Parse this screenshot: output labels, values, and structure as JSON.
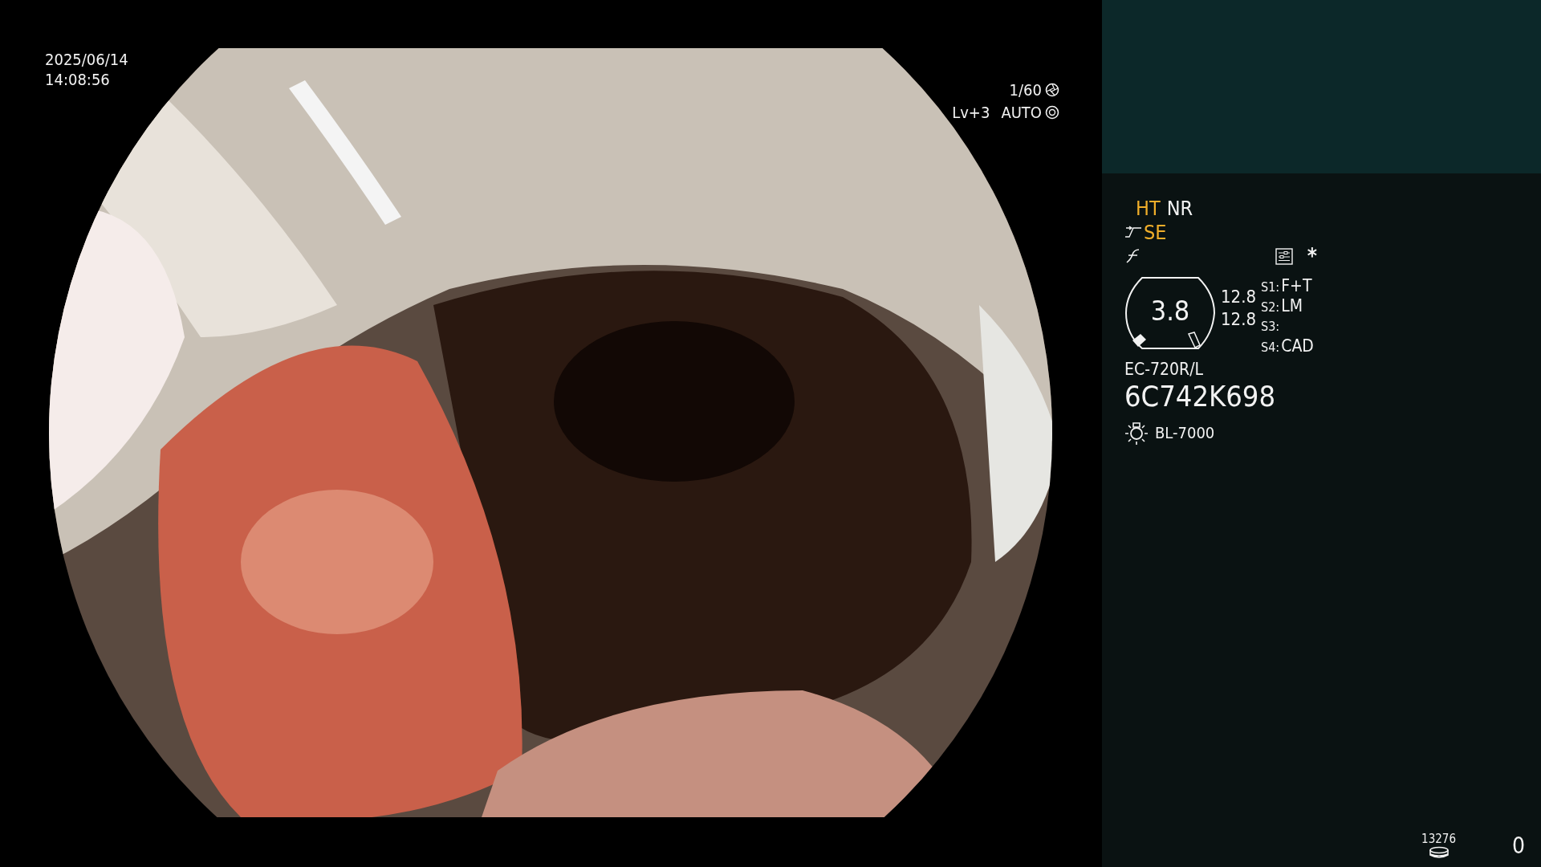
{
  "timestamp": {
    "date": "2025/06/14",
    "time": "14:08:56"
  },
  "camera": {
    "shutter": "1/60",
    "level": "Lv+3",
    "iris": "AUTO"
  },
  "modes": [
    {
      "label": "HT",
      "active": true
    },
    {
      "label": "NR",
      "active": false
    }
  ],
  "enhancement": {
    "label": "SE",
    "active": true
  },
  "asterisk": "*",
  "gauge": {
    "value": "3.8"
  },
  "readings": [
    "12.8",
    "12.8"
  ],
  "switches": [
    {
      "key": "S1:",
      "value": "F+T"
    },
    {
      "key": "S2:",
      "value": "LM"
    },
    {
      "key": "S3:"
    },
    {
      "key": "S4:",
      "value": "CAD"
    }
  ],
  "scope": {
    "model": "EC-720R/L",
    "serial": "6C742K698"
  },
  "light_source": "BL-7000",
  "storage": {
    "count": "13276"
  },
  "counter": "0"
}
